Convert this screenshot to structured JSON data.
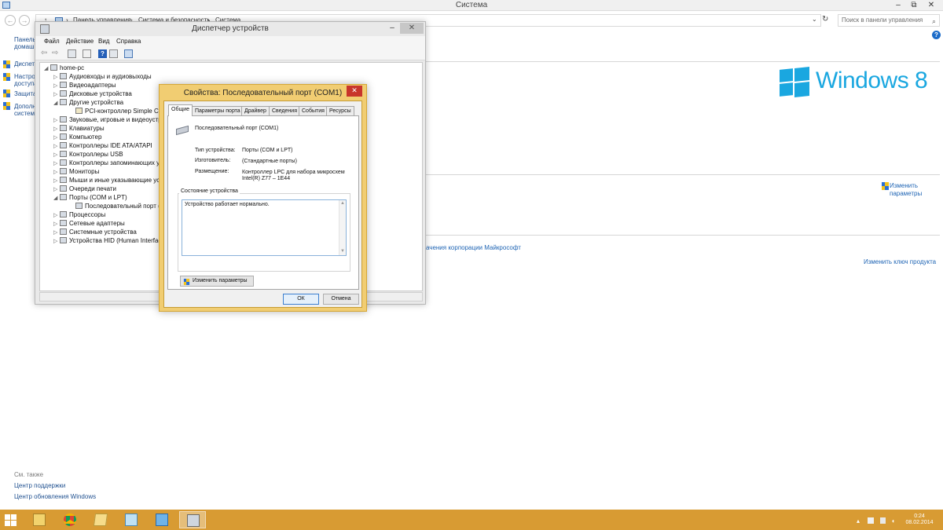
{
  "system_window": {
    "title": "Система",
    "minimize": "–",
    "restore": "⧉",
    "close": "✕",
    "breadcrumb": [
      "Панель управления",
      "Система и безопасность",
      "Система"
    ],
    "breadcrumb_sep": "›",
    "search_placeholder": "Поиск в панели управления",
    "help": "?",
    "left_nav": {
      "home_line1": "Панель",
      "home_line2": "домаш",
      "items": [
        {
          "line1": "Диспетч",
          "line2": ""
        },
        {
          "line1": "Настрой",
          "line2": "доступа"
        },
        {
          "line1": "Защита",
          "line2": ""
        },
        {
          "line1": "Дополн",
          "line2": "систем"
        }
      ]
    },
    "windows_logo_text": "Windows 8",
    "change_settings": {
      "line1": "Изменить",
      "line2": "параметры"
    },
    "license_link": "ачения корпорации Майкрософт",
    "change_key_link": "Изменить ключ продукта",
    "see_also": "См. также",
    "support_link": "Центр поддержки",
    "update_link": "Центр обновления Windows"
  },
  "device_manager": {
    "title": "Диспетчер устройств",
    "minimize": "–",
    "maximize": "□",
    "close": "✕",
    "menu": [
      "Файл",
      "Действие",
      "Вид",
      "Справка"
    ],
    "tree": [
      {
        "text": "home-pc",
        "level": 0,
        "exp": "◢"
      },
      {
        "text": "Аудиовходы и аудиовыходы",
        "level": 1,
        "exp": "▷"
      },
      {
        "text": "Видеоадаптеры",
        "level": 1,
        "exp": "▷"
      },
      {
        "text": "Дисковые устройства",
        "level": 1,
        "exp": "▷"
      },
      {
        "text": "Другие устройства",
        "level": 1,
        "exp": "◢"
      },
      {
        "text": "PCI-контроллер Simple Comr",
        "level": 2,
        "exp": ""
      },
      {
        "text": "Звуковые, игровые и видеоустр",
        "level": 1,
        "exp": "▷"
      },
      {
        "text": "Клавиатуры",
        "level": 1,
        "exp": "▷"
      },
      {
        "text": "Компьютер",
        "level": 1,
        "exp": "▷"
      },
      {
        "text": "Контроллеры IDE ATA/ATAPI",
        "level": 1,
        "exp": "▷"
      },
      {
        "text": "Контроллеры USB",
        "level": 1,
        "exp": "▷"
      },
      {
        "text": "Контроллеры запоминающих ус",
        "level": 1,
        "exp": "▷"
      },
      {
        "text": "Мониторы",
        "level": 1,
        "exp": "▷"
      },
      {
        "text": "Мыши и иные указывающие уст",
        "level": 1,
        "exp": "▷"
      },
      {
        "text": "Очереди печати",
        "level": 1,
        "exp": "▷"
      },
      {
        "text": "Порты (COM и LPT)",
        "level": 1,
        "exp": "◢"
      },
      {
        "text": "Последовательный порт (COI",
        "level": 2,
        "exp": ""
      },
      {
        "text": "Процессоры",
        "level": 1,
        "exp": "▷"
      },
      {
        "text": "Сетевые адаптеры",
        "level": 1,
        "exp": "▷"
      },
      {
        "text": "Системные устройства",
        "level": 1,
        "exp": "▷"
      },
      {
        "text": "Устройства HID (Human Interface",
        "level": 1,
        "exp": "▷"
      }
    ]
  },
  "properties": {
    "title": "Свойства: Последовательный порт (COM1)",
    "close": "✕",
    "tabs": [
      "Общие",
      "Параметры порта",
      "Драйвер",
      "Сведения",
      "События",
      "Ресурсы"
    ],
    "device_name": "Последовательный порт (COM1)",
    "type_label": "Тип устройства:",
    "type_value": "Порты (COM и LPT)",
    "manufacturer_label": "Изготовитель:",
    "manufacturer_value": "(Стандартные порты)",
    "location_label": "Размещение:",
    "location_value_1": "Контроллер LPC для набора микросхем",
    "location_value_2": "Intel(R) Z77 – 1E44",
    "status_legend": "Состояние устройства",
    "status_text": "Устройство работает нормально.",
    "scroll_up": "▲",
    "scroll_down": "▼",
    "change_button": "Изменить параметры",
    "ok": "ОК",
    "cancel": "Отмена"
  },
  "taskbar": {
    "time": "0:24",
    "date": "08.02.2014",
    "apps": [
      "file-explorer",
      "chrome",
      "folder",
      "notepad",
      "control-panel",
      "device-manager"
    ],
    "active_app": "device-manager"
  },
  "colors": {
    "taskbar": "#d89b33",
    "dialog_frame": "#f1cd72",
    "windows_blue": "#1aa7e0",
    "link": "#1e64b4",
    "close_red": "#c8352b"
  }
}
